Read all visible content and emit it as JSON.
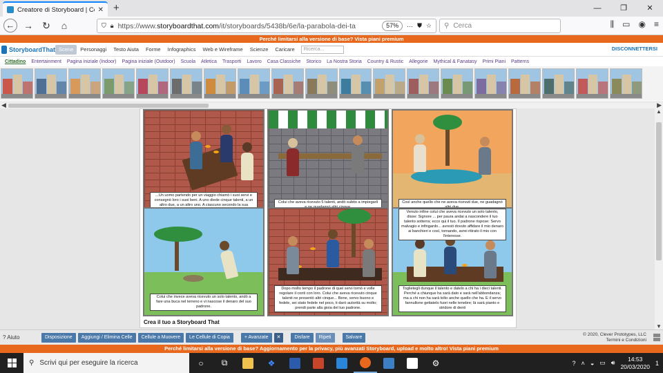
{
  "browser": {
    "tab_title": "Creatore di Storyboard | Come c",
    "url_prefix": "https://www.",
    "url_host": "storyboardthat.com",
    "url_path": "/it/storyboards/5438b/6e/la-parabola-dei-ta",
    "zoom": "57%",
    "search_placeholder": "Cerca"
  },
  "site": {
    "promo_top": "Perché limitarsi alla versione di base? Vista piani premium",
    "logo_text": "StoryboardThat",
    "menu": [
      "Scene",
      "Personaggi",
      "Testo Aiuta",
      "Forme",
      "Infographics",
      "Web e Wireframe",
      "Scienze",
      "Caricare"
    ],
    "search_placeholder": "Ricerca...",
    "disconnect": "DISCONNETTERSI",
    "categories": [
      "Cittadino",
      "Entertainment",
      "Pagina iniziale (Indoor)",
      "Pagina iniziale (Outdoor)",
      "Scuola",
      "Atletica",
      "Trasporti",
      "Lavoro",
      "Casa Classiche",
      "Storico",
      "La Nostra Storia",
      "Country & Rustic",
      "Allegorie",
      "Mythical & Fanatasy",
      "Primi Piani",
      "Patterns"
    ]
  },
  "scenes": [
    "#c9574a",
    "#4f6f95",
    "#d89a5b",
    "#7d9a6a",
    "#b7485c",
    "#6c6c6c",
    "#cf8c3f",
    "#5b8db8",
    "#a86450",
    "#8a7a5a",
    "#3e7c9e",
    "#c4a06a",
    "#9e5e5e",
    "#6a8a4e",
    "#7d6ca0",
    "#b86a3e",
    "#4e6e6e",
    "#c25a5a",
    "#8a8a5a"
  ],
  "storyboard": {
    "captions": [
      "...Un uomo partendo per un viaggio chiamò i suoi servi e consegnò loro i suoi beni. A uno diede cinque talenti, a un altro due, a un altro uno. A ciascuno secondo la sua capacità e partì.",
      "Colui che aveva ricevuto 5 talenti, andò subito a impiegarli e ne guadagnò altri cinque.",
      "Così anche quello che ne aveva ricevuti due, ne guadagnò altri due.",
      "Colui che invece aveva ricevuto un solo talento, andò a fare una buca nel terreno e vi nascose il denaro del suo padrone.",
      "Dopo molto tempo il padrone di quei servi tornò e volle regolare il conti con loro. Colui che aveva ricevuto cinque talenti ne presentò altri cinque... Bene, servo buono e fedele, sei stato fedele nel poco, ti darò autorità su molto; prendi parte alla gioia del tuo padrone.",
      "Venuto infine colui che aveva ricevuto un solo talento, disse: Signore ... per paura andai a nascondere il tuo talento sotterra; ecco qui il tuo. Il padrone rispose: Servo malvagio e infingardo... avresti dovuto affidare il mio denaro ai banchieri e così, tornando, avrei ritirato il mio con l'interesse.",
      "Toglietegli dunque il talento e datelo a chi ha i dieci talenti. Perché a chiunque ha sarà dato e sarà nell'abbondanza; ma a chi non ha sarà tolto anche quello che ha. E il servo fannullone gettatelo fuori nelle tenebre; là sarà pianto e stridore di denti"
    ],
    "footer": "Crea il tuo a Storyboard That"
  },
  "toolbar": {
    "help": "? Aiuto",
    "buttons": [
      "Disposizione",
      "Aggiungi / Elimina Celle",
      "Cellule a Muovere",
      "Le Cellule di Copia",
      "+ Avanzate",
      "Disfare",
      "Ripeti",
      "Salvare"
    ],
    "copyright_line1": "© 2020, Clever Prototypes, LLC",
    "copyright_line2": "Termini e Condizioni"
  },
  "promo_bottom": "Perché limitarsi alla versione di base? Aggiornamento per la privacy, più avanzati Storyboard, upload e molto altro! Vista piani premium",
  "taskbar": {
    "search_placeholder": "Scrivi qui per eseguire la ricerca",
    "time": "14:53",
    "date": "20/03/2020",
    "notifications": "1"
  },
  "colors": {
    "promo": "#e8681e",
    "toolbar_button": "#4a78a8",
    "brand": "#1c73b8",
    "category_text": "#5a3a86"
  }
}
